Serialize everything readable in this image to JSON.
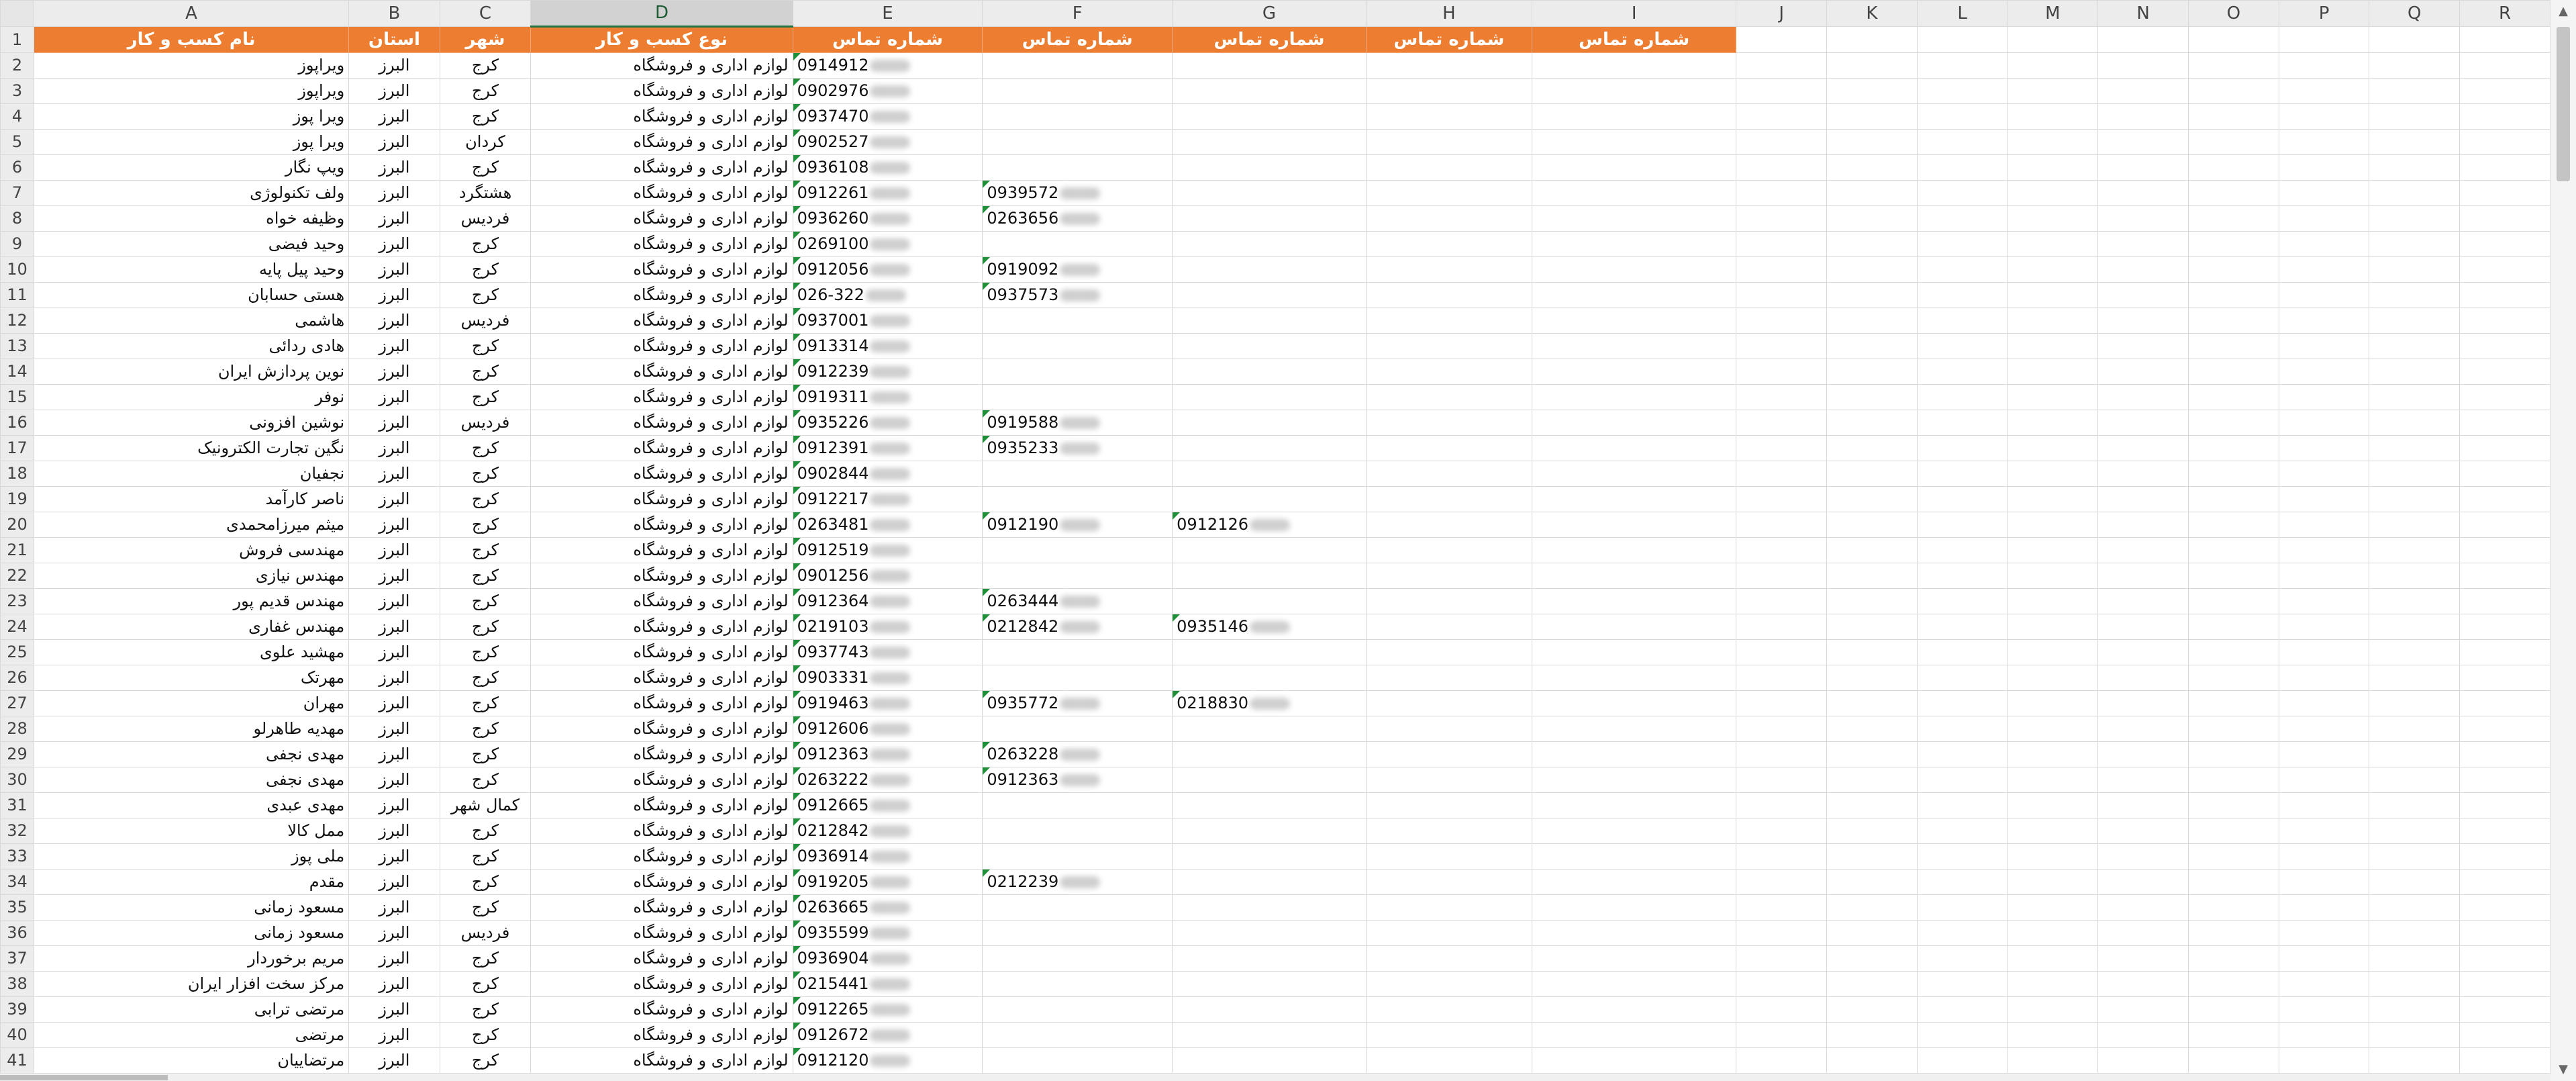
{
  "sheet": {
    "columns": [
      "A",
      "B",
      "C",
      "D",
      "E",
      "F",
      "G",
      "H",
      "I",
      "J",
      "K",
      "L",
      "M",
      "N",
      "O",
      "P",
      "Q",
      "R"
    ],
    "selected_column": "D",
    "header": {
      "business_name": "نام کسب و کار",
      "province": "استان",
      "city": "شهر",
      "business_type": "نوع کسب و کار",
      "phone_1": "شماره تماس",
      "phone_2": "شماره تماس",
      "phone_3": "شماره تماس",
      "phone_4": "شماره تماس",
      "phone_5": "شماره تماس"
    },
    "header_color": "#ed7d31",
    "rows": [
      {
        "n": "2",
        "name": "ویراپوز",
        "province": "البرز",
        "city": "کرج",
        "type": "لوازم اداری و فروشگاه",
        "p1": "0914912",
        "p2": "",
        "p3": ""
      },
      {
        "n": "3",
        "name": "ویراپوز",
        "province": "البرز",
        "city": "کرج",
        "type": "لوازم اداری و فروشگاه",
        "p1": "0902976",
        "p2": "",
        "p3": ""
      },
      {
        "n": "4",
        "name": "ویرا پوز",
        "province": "البرز",
        "city": "کرج",
        "type": "لوازم اداری و فروشگاه",
        "p1": "0937470",
        "p2": "",
        "p3": ""
      },
      {
        "n": "5",
        "name": "ویرا پوز",
        "province": "البرز",
        "city": "کردان",
        "type": "لوازم اداری و فروشگاه",
        "p1": "0902527",
        "p2": "",
        "p3": ""
      },
      {
        "n": "6",
        "name": "ویپ نگار",
        "province": "البرز",
        "city": "کرج",
        "type": "لوازم اداری و فروشگاه",
        "p1": "0936108",
        "p2": "",
        "p3": ""
      },
      {
        "n": "7",
        "name": "ولف تکنولوژی",
        "province": "البرز",
        "city": "هشتگرد",
        "type": "لوازم اداری و فروشگاه",
        "p1": "0912261",
        "p2": "0939572",
        "p3": ""
      },
      {
        "n": "8",
        "name": "وظیفه خواه",
        "province": "البرز",
        "city": "فردیس",
        "type": "لوازم اداری و فروشگاه",
        "p1": "0936260",
        "p2": "0263656",
        "p3": ""
      },
      {
        "n": "9",
        "name": "وحید فیضی",
        "province": "البرز",
        "city": "کرج",
        "type": "لوازم اداری و فروشگاه",
        "p1": "0269100",
        "p2": "",
        "p3": ""
      },
      {
        "n": "10",
        "name": "وحید پیل پایه",
        "province": "البرز",
        "city": "کرج",
        "type": "لوازم اداری و فروشگاه",
        "p1": "0912056",
        "p2": "0919092",
        "p3": ""
      },
      {
        "n": "11",
        "name": "هستی حسابان",
        "province": "البرز",
        "city": "کرج",
        "type": "لوازم اداری و فروشگاه",
        "p1": "026-322",
        "p2": "0937573",
        "p3": ""
      },
      {
        "n": "12",
        "name": "هاشمی",
        "province": "البرز",
        "city": "فردیس",
        "type": "لوازم اداری و فروشگاه",
        "p1": "0937001",
        "p2": "",
        "p3": ""
      },
      {
        "n": "13",
        "name": "هادی ردائی",
        "province": "البرز",
        "city": "کرج",
        "type": "لوازم اداری و فروشگاه",
        "p1": "0913314",
        "p2": "",
        "p3": ""
      },
      {
        "n": "14",
        "name": "نوین پردازش ایران",
        "province": "البرز",
        "city": "کرج",
        "type": "لوازم اداری و فروشگاه",
        "p1": "0912239",
        "p2": "",
        "p3": ""
      },
      {
        "n": "15",
        "name": "نوفر",
        "province": "البرز",
        "city": "کرج",
        "type": "لوازم اداری و فروشگاه",
        "p1": "0919311",
        "p2": "",
        "p3": ""
      },
      {
        "n": "16",
        "name": "نوشین افزونی",
        "province": "البرز",
        "city": "فردیس",
        "type": "لوازم اداری و فروشگاه",
        "p1": "0935226",
        "p2": "0919588",
        "p3": ""
      },
      {
        "n": "17",
        "name": "نگین تجارت الکترونیک",
        "province": "البرز",
        "city": "کرج",
        "type": "لوازم اداری و فروشگاه",
        "p1": "0912391",
        "p2": "0935233",
        "p3": ""
      },
      {
        "n": "18",
        "name": "نجفیان",
        "province": "البرز",
        "city": "کرج",
        "type": "لوازم اداری و فروشگاه",
        "p1": "0902844",
        "p2": "",
        "p3": ""
      },
      {
        "n": "19",
        "name": "ناصر کارآمد",
        "province": "البرز",
        "city": "کرج",
        "type": "لوازم اداری و فروشگاه",
        "p1": "0912217",
        "p2": "",
        "p3": ""
      },
      {
        "n": "20",
        "name": "میثم میرزامحمدی",
        "province": "البرز",
        "city": "کرج",
        "type": "لوازم اداری و فروشگاه",
        "p1": "0263481",
        "p2": "0912190",
        "p3": "0912126"
      },
      {
        "n": "21",
        "name": "مهندسی فروش",
        "province": "البرز",
        "city": "کرج",
        "type": "لوازم اداری و فروشگاه",
        "p1": "0912519",
        "p2": "",
        "p3": ""
      },
      {
        "n": "22",
        "name": "مهندس نیازی",
        "province": "البرز",
        "city": "کرج",
        "type": "لوازم اداری و فروشگاه",
        "p1": "0901256",
        "p2": "",
        "p3": ""
      },
      {
        "n": "23",
        "name": "مهندس قدیم پور",
        "province": "البرز",
        "city": "کرج",
        "type": "لوازم اداری و فروشگاه",
        "p1": "0912364",
        "p2": "0263444",
        "p3": ""
      },
      {
        "n": "24",
        "name": "مهندس غفاری",
        "province": "البرز",
        "city": "کرج",
        "type": "لوازم اداری و فروشگاه",
        "p1": "0219103",
        "p2": "0212842",
        "p3": "0935146"
      },
      {
        "n": "25",
        "name": "مهشید علوی",
        "province": "البرز",
        "city": "کرج",
        "type": "لوازم اداری و فروشگاه",
        "p1": "0937743",
        "p2": "",
        "p3": ""
      },
      {
        "n": "26",
        "name": "مهرتک",
        "province": "البرز",
        "city": "کرج",
        "type": "لوازم اداری و فروشگاه",
        "p1": "0903331",
        "p2": "",
        "p3": ""
      },
      {
        "n": "27",
        "name": "مهران",
        "province": "البرز",
        "city": "کرج",
        "type": "لوازم اداری و فروشگاه",
        "p1": "0919463",
        "p2": "0935772",
        "p3": "0218830"
      },
      {
        "n": "28",
        "name": "مهدیه طاهرلو",
        "province": "البرز",
        "city": "کرج",
        "type": "لوازم اداری و فروشگاه",
        "p1": "0912606",
        "p2": "",
        "p3": ""
      },
      {
        "n": "29",
        "name": "مهدی نجفی",
        "province": "البرز",
        "city": "کرج",
        "type": "لوازم اداری و فروشگاه",
        "p1": "0912363",
        "p2": "0263228",
        "p3": ""
      },
      {
        "n": "30",
        "name": "مهدی نجفی",
        "province": "البرز",
        "city": "کرج",
        "type": "لوازم اداری و فروشگاه",
        "p1": "0263222",
        "p2": "0912363",
        "p3": ""
      },
      {
        "n": "31",
        "name": "مهدی عبدی",
        "province": "البرز",
        "city": "کمال شهر",
        "type": "لوازم اداری و فروشگاه",
        "p1": "0912665",
        "p2": "",
        "p3": ""
      },
      {
        "n": "32",
        "name": "ممل کالا",
        "province": "البرز",
        "city": "کرج",
        "type": "لوازم اداری و فروشگاه",
        "p1": "0212842",
        "p2": "",
        "p3": ""
      },
      {
        "n": "33",
        "name": "ملی پوز",
        "province": "البرز",
        "city": "کرج",
        "type": "لوازم اداری و فروشگاه",
        "p1": "0936914",
        "p2": "",
        "p3": ""
      },
      {
        "n": "34",
        "name": "مقدم",
        "province": "البرز",
        "city": "کرج",
        "type": "لوازم اداری و فروشگاه",
        "p1": "0919205",
        "p2": "0212239",
        "p3": ""
      },
      {
        "n": "35",
        "name": "مسعود زمانی",
        "province": "البرز",
        "city": "کرج",
        "type": "لوازم اداری و فروشگاه",
        "p1": "0263665",
        "p2": "",
        "p3": ""
      },
      {
        "n": "36",
        "name": "مسعود زمانی",
        "province": "البرز",
        "city": "فردیس",
        "type": "لوازم اداری و فروشگاه",
        "p1": "0935599",
        "p2": "",
        "p3": ""
      },
      {
        "n": "37",
        "name": "مریم برخوردار",
        "province": "البرز",
        "city": "کرج",
        "type": "لوازم اداری و فروشگاه",
        "p1": "0936904",
        "p2": "",
        "p3": ""
      },
      {
        "n": "38",
        "name": "مرکز سخت افزار ایران",
        "province": "البرز",
        "city": "کرج",
        "type": "لوازم اداری و فروشگاه",
        "p1": "0215441",
        "p2": "",
        "p3": ""
      },
      {
        "n": "39",
        "name": "مرتضی ترابی",
        "province": "البرز",
        "city": "کرج",
        "type": "لوازم اداری و فروشگاه",
        "p1": "0912265",
        "p2": "",
        "p3": ""
      },
      {
        "n": "40",
        "name": "مرتضی",
        "province": "البرز",
        "city": "کرج",
        "type": "لوازم اداری و فروشگاه",
        "p1": "0912672",
        "p2": "",
        "p3": ""
      },
      {
        "n": "41",
        "name": "مرتضاییان",
        "province": "البرز",
        "city": "کرج",
        "type": "لوازم اداری و فروشگاه",
        "p1": "0912120",
        "p2": "",
        "p3": ""
      }
    ]
  },
  "scrollbar": {
    "up_arrow_icon": "▲",
    "down_arrow_icon": "▼"
  }
}
